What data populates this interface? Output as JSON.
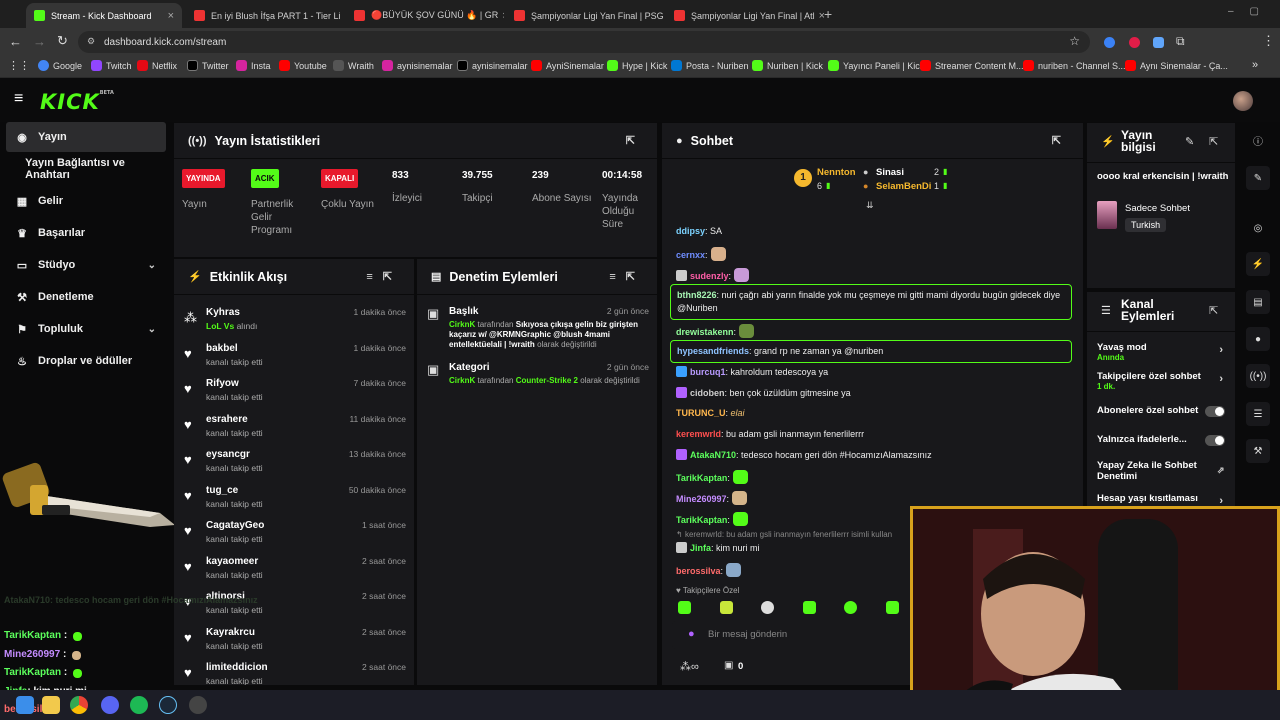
{
  "browser": {
    "tabs": [
      {
        "title": "Stream - Kick Dashboard",
        "active": true,
        "color": "#53fc18"
      },
      {
        "title": "En iyi Blush İfşa PART 1 - Tier Li",
        "active": false,
        "color": "#e33"
      },
      {
        "title": "🔴BÜYÜK ŞOV GÜNÜ 🔥 | GR",
        "active": false,
        "color": "#e33"
      },
      {
        "title": "Şampiyonlar Ligi Yan Final | PSG",
        "active": false,
        "color": "#e33"
      },
      {
        "title": "Şampiyonlar Ligi Yan Final | Atl",
        "active": false,
        "color": "#e33"
      }
    ],
    "url": "dashboard.kick.com/stream",
    "bookmarks": [
      {
        "label": "Google",
        "color": "#4285f4"
      },
      {
        "label": "Twitch",
        "color": "#9146ff"
      },
      {
        "label": "Netflix",
        "color": "#e50914"
      },
      {
        "label": "Twitter",
        "color": "#000000"
      },
      {
        "label": "Insta",
        "color": "#d6249f"
      },
      {
        "label": "Youtube",
        "color": "#ff0000"
      },
      {
        "label": "Wraith",
        "color": "#333333"
      },
      {
        "label": "aynisinemalar",
        "color": "#d6249f"
      },
      {
        "label": "aynisinemalar",
        "color": "#000000"
      },
      {
        "label": "AyniSinemalar",
        "color": "#ff0000"
      },
      {
        "label": "Hype | Kick",
        "color": "#53fc18"
      },
      {
        "label": "Posta - Nuriben",
        "color": "#0078d4"
      },
      {
        "label": "Nuriben | Kick",
        "color": "#53fc18"
      },
      {
        "label": "Yayıncı Paneli | Kick",
        "color": "#53fc18"
      },
      {
        "label": "Streamer Content M...",
        "color": "#ff0000"
      },
      {
        "label": "nuriben - Channel S...",
        "color": "#ff0000"
      },
      {
        "label": "Aynı Sinemalar - Ça...",
        "color": "#ff0000"
      }
    ]
  },
  "kick": {
    "logo": "KICK",
    "logo_beta": "BETA"
  },
  "sidebar": {
    "items": [
      {
        "label": "Yayın",
        "icon": "broadcast-icon",
        "glyph": "◉"
      },
      {
        "label": "Yayın Bağlantısı ve Anahtarı",
        "icon": "",
        "glyph": ""
      },
      {
        "label": "Gelir",
        "icon": "revenue-icon",
        "glyph": "▦"
      },
      {
        "label": "Başarılar",
        "icon": "trophy-icon",
        "glyph": "♛"
      },
      {
        "label": "Stüdyo",
        "icon": "studio-icon",
        "glyph": "▭"
      },
      {
        "label": "Denetleme",
        "icon": "hammer-icon",
        "glyph": "⚒"
      },
      {
        "label": "Topluluk",
        "icon": "community-icon",
        "glyph": "⚑"
      },
      {
        "label": "Droplar ve ödüller",
        "icon": "drops-icon",
        "glyph": "♨"
      }
    ]
  },
  "stats": {
    "title": "Yayın İstatistikleri",
    "items": [
      {
        "tag": "YAYINDA",
        "tag_color": "#e8192c",
        "label": "Yayın"
      },
      {
        "tag": "ACIK",
        "tag_color": "#53fc18",
        "label": "Partnerlik Gelir Programı"
      },
      {
        "tag": "KAPALI",
        "tag_color": "#e8192c",
        "label": "Çoklu Yayın"
      },
      {
        "value": "833",
        "label": "İzleyici"
      },
      {
        "value": "39.755",
        "label": "Takipçi"
      },
      {
        "value": "239",
        "label": "Abone Sayısı"
      },
      {
        "value": "00:14:58",
        "label": "Yayında Olduğu Süre"
      }
    ]
  },
  "activity": {
    "title": "Etkinlik Akışı",
    "rows": [
      {
        "name": "Kyhras",
        "sub_green": "LoL Vs",
        "sub": "alındı",
        "time": "1 dakika önce",
        "icon": "prediction-icon"
      },
      {
        "name": "bakbel",
        "sub": "kanalı takip etti",
        "time": "1 dakika önce",
        "icon": "heart-icon"
      },
      {
        "name": "Rifyow",
        "sub": "kanalı takip etti",
        "time": "7 dakika önce",
        "icon": "heart-icon"
      },
      {
        "name": "esrahere",
        "sub": "kanalı takip etti",
        "time": "11 dakika önce",
        "icon": "heart-icon"
      },
      {
        "name": "eysancgr",
        "sub": "kanalı takip etti",
        "time": "13 dakika önce",
        "icon": "heart-icon"
      },
      {
        "name": "tug_ce",
        "sub": "kanalı takip etti",
        "time": "50 dakika önce",
        "icon": "heart-icon"
      },
      {
        "name": "CagatayGeo",
        "sub": "kanalı takip etti",
        "time": "1 saat önce",
        "icon": "heart-icon"
      },
      {
        "name": "kayaomeer",
        "sub": "kanalı takip etti",
        "time": "2 saat önce",
        "icon": "heart-icon"
      },
      {
        "name": "altinorsi",
        "sub": "kanalı takip etti",
        "time": "2 saat önce",
        "icon": "heart-icon"
      },
      {
        "name": "Kayrakrcu",
        "sub": "kanalı takip etti",
        "time": "2 saat önce",
        "icon": "heart-icon"
      },
      {
        "name": "limiteddicion",
        "sub": "kanalı takip etti",
        "time": "2 saat önce",
        "icon": "heart-icon"
      }
    ]
  },
  "moderation": {
    "title": "Denetim Eylemleri",
    "rows": [
      {
        "title": "Başlık",
        "time": "2 gün önce",
        "actor": "CirknK",
        "by": "tarafından",
        "value": "Sıkıyosa çıkışa gelin biz girişten kaçarız w/ @KRMNGraphic @blush 4mami entellektüelali | !wraith",
        "suffix": "olarak değiştirildi"
      },
      {
        "title": "Kategori",
        "time": "2 gün önce",
        "actor": "CirknK",
        "by": "tarafından",
        "value": "Counter-Strike 2",
        "suffix": "olarak değiştirildi"
      }
    ]
  },
  "chat": {
    "title": "Sohbet",
    "leaders": [
      {
        "rank": "1",
        "name": "Nennton",
        "count": "6"
      },
      {
        "rank": "",
        "name": "Sinasi",
        "count": "2"
      },
      {
        "rank": "",
        "name": "SelamBenDi",
        "count": "1"
      }
    ],
    "messages": [
      {
        "user": "ddipsy",
        "color": "#7cd3ff",
        "text": "SA"
      },
      {
        "user": "cernxx",
        "color": "#6f8dff",
        "text": "",
        "emote": "#d8b08c"
      },
      {
        "user": "sudenzly",
        "color": "#ff5ea8",
        "text": "",
        "emote": "#c89ad8",
        "badge": "#cccccc"
      },
      {
        "user": "bthn8226",
        "color": "#a7f5b4",
        "text": "nuri çağrı abi yarın finalde yok mu çeşmeye mi gitti mami diyordu bugün gidecek diye @Nuriben",
        "highlight": true
      },
      {
        "user": "drewistakenn",
        "color": "#93ff9b",
        "text": "",
        "emote": "#6a8d3c"
      },
      {
        "user": "hypesandfriends",
        "color": "#8fc3ff",
        "text": "grand rp ne zaman ya @nuriben",
        "highlight": true
      },
      {
        "user": "burcuq1",
        "color": "#b99bff",
        "text": "kahroldum tedescoya ya",
        "badge": "#3aa0ff"
      },
      {
        "user": "cidoben",
        "color": "#cfcfcf",
        "text": "ben çok üzüldüm gitmesine ya",
        "badge": "#b061ff"
      },
      {
        "user": "TURUNC_U",
        "color": "#ffb74d",
        "text": "elai"
      },
      {
        "user": "keremwrld",
        "color": "#ff4f4f",
        "text": "bu adam gsli inanmayın fenerlilerrr"
      },
      {
        "user": "AtakaN710",
        "color": "#5cff5c",
        "text": "tedesco hocam geri dön #HocamızıAlamazsınız",
        "badge": "#b061ff"
      },
      {
        "user": "TarikKaptan",
        "color": "#5cff5c",
        "text": "",
        "emote": "#53fc18"
      },
      {
        "user": "Mine260997",
        "color": "#c48cff",
        "text": "",
        "emote": "#d4b48a"
      },
      {
        "user": "TarikKaptan",
        "color": "#5cff5c",
        "text": "",
        "emote": "#53fc18"
      },
      {
        "user": "Jinfa",
        "color": "#5cff5c",
        "text": "kim nuri mi",
        "badge": "#cccccc",
        "reply": "keremwrld: bu adam gsli inanmayın fenerlilerrr isimli kullan"
      },
      {
        "user": "berossilva",
        "color": "#ff6b6b",
        "text": "",
        "emote": "#8aa8c8"
      }
    ],
    "followers_only": "Takipçilere Özel",
    "placeholder": "Bir mesaj gönderin",
    "footer_count": "0"
  },
  "stream_info": {
    "title": "Yayın bilgisi",
    "stream_title": "oooo kral erkencisin | !wraith",
    "mode": "Sadece Sohbet",
    "language": "Turkish"
  },
  "channel_actions": {
    "title": "Kanal Eylemleri",
    "items": [
      {
        "label": "Yavaş mod",
        "sub": "Anında",
        "control": "arrow"
      },
      {
        "label": "Takipçilere özel sohbet",
        "sub": "1 dk.",
        "control": "arrow"
      },
      {
        "label": "Abonelere özel sohbet",
        "sub": "",
        "control": "toggle"
      },
      {
        "label": "Yalnızca ifadelerle...",
        "sub": "",
        "control": "toggle"
      },
      {
        "label": "Yapay Zeka ile Sohbet Denetimi",
        "sub": "",
        "control": "external"
      },
      {
        "label": "Hesap yaşı kısıtlaması",
        "sub": "",
        "control": "arrow"
      }
    ]
  },
  "overlay_chat": [
    {
      "user": "AtakaN710",
      "text": ": tedesco hocam geri dön #HocamızıAlamazsınız",
      "faded": true
    },
    {
      "user": "TarikKaptan",
      "text": ":",
      "faded": false
    },
    {
      "user": "Mine260997",
      "text": ":",
      "faded": false
    },
    {
      "user": "TarikKaptan",
      "text": ":",
      "faded": false
    },
    {
      "user": "Jinfa",
      "text": ": kim nuri mi",
      "faded": false
    },
    {
      "user": "berossilva",
      "text": ":",
      "faded": false
    }
  ]
}
